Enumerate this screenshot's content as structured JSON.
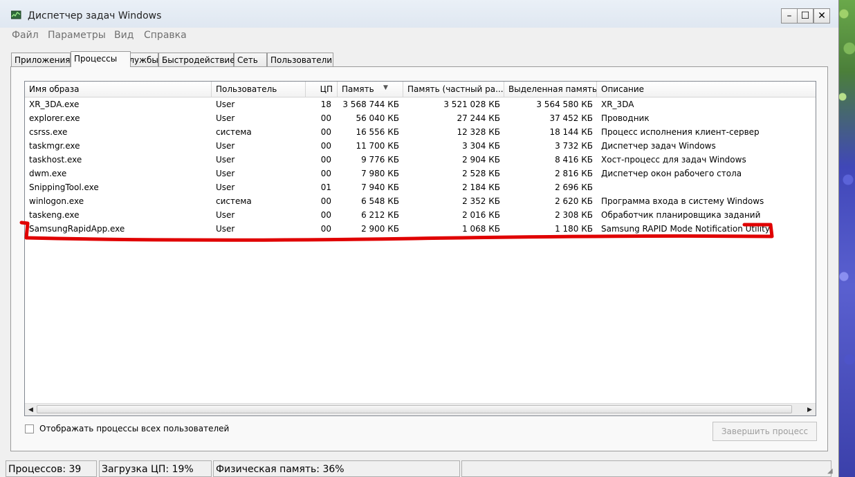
{
  "window": {
    "title": "Диспетчер задач Windows",
    "buttons": {
      "minimize": "–",
      "maximize": "☐",
      "close": "✕"
    }
  },
  "menu": [
    "Файл",
    "Параметры",
    "Вид",
    "Справка"
  ],
  "tabs": [
    "Приложения",
    "Процессы",
    "Службы",
    "Быстродействие",
    "Сеть",
    "Пользователи"
  ],
  "active_tab": "Процессы",
  "table": {
    "columns": [
      "Имя образа",
      "Пользователь",
      "ЦП",
      "Память",
      "Память (частный ра...",
      "Выделенная память",
      "Описание"
    ],
    "sort_indicator": "▼",
    "rows": [
      [
        "XR_3DA.exe",
        "User",
        "18",
        "3 568 744 КБ",
        "3 521 028 КБ",
        "3 564 580 КБ",
        "XR_3DA"
      ],
      [
        "explorer.exe",
        "User",
        "00",
        "56 040 КБ",
        "27 244 КБ",
        "37 452 КБ",
        "Проводник"
      ],
      [
        "csrss.exe",
        "система",
        "00",
        "16 556 КБ",
        "12 328 КБ",
        "18 144 КБ",
        "Процесс исполнения клиент-сервер"
      ],
      [
        "taskmgr.exe",
        "User",
        "00",
        "11 700 КБ",
        "3 304 КБ",
        "3 732 КБ",
        "Диспетчер задач Windows"
      ],
      [
        "taskhost.exe",
        "User",
        "00",
        "9 776 КБ",
        "2 904 КБ",
        "8 416 КБ",
        "Хост-процесс для задач Windows"
      ],
      [
        "dwm.exe",
        "User",
        "00",
        "7 980 КБ",
        "2 528 КБ",
        "2 816 КБ",
        "Диспетчер окон рабочего стола"
      ],
      [
        "SnippingTool.exe",
        "User",
        "01",
        "7 940 КБ",
        "2 184 КБ",
        "2 696 КБ",
        ""
      ],
      [
        "winlogon.exe",
        "система",
        "00",
        "6 548 КБ",
        "2 352 КБ",
        "2 620 КБ",
        "Программа входа в систему Windows"
      ],
      [
        "taskeng.exe",
        "User",
        "00",
        "6 212 КБ",
        "2 016 КБ",
        "2 308 КБ",
        "Обработчик планировщика заданий"
      ],
      [
        "SamsungRapidApp.exe",
        "User",
        "00",
        "2 900 КБ",
        "1 068 КБ",
        "1 180 КБ",
        "Samsung RAPID Mode Notification Utility"
      ]
    ]
  },
  "show_all_processes_label": "Отображать процессы всех пользователей",
  "end_process_label": "Завершить процесс",
  "status": {
    "processes": "Процессов: 39",
    "cpu": "Загрузка ЦП: 19%",
    "memory": "Физическая память: 36%"
  },
  "colors": {
    "annotation": "#e00000",
    "list_border": "#828790"
  }
}
